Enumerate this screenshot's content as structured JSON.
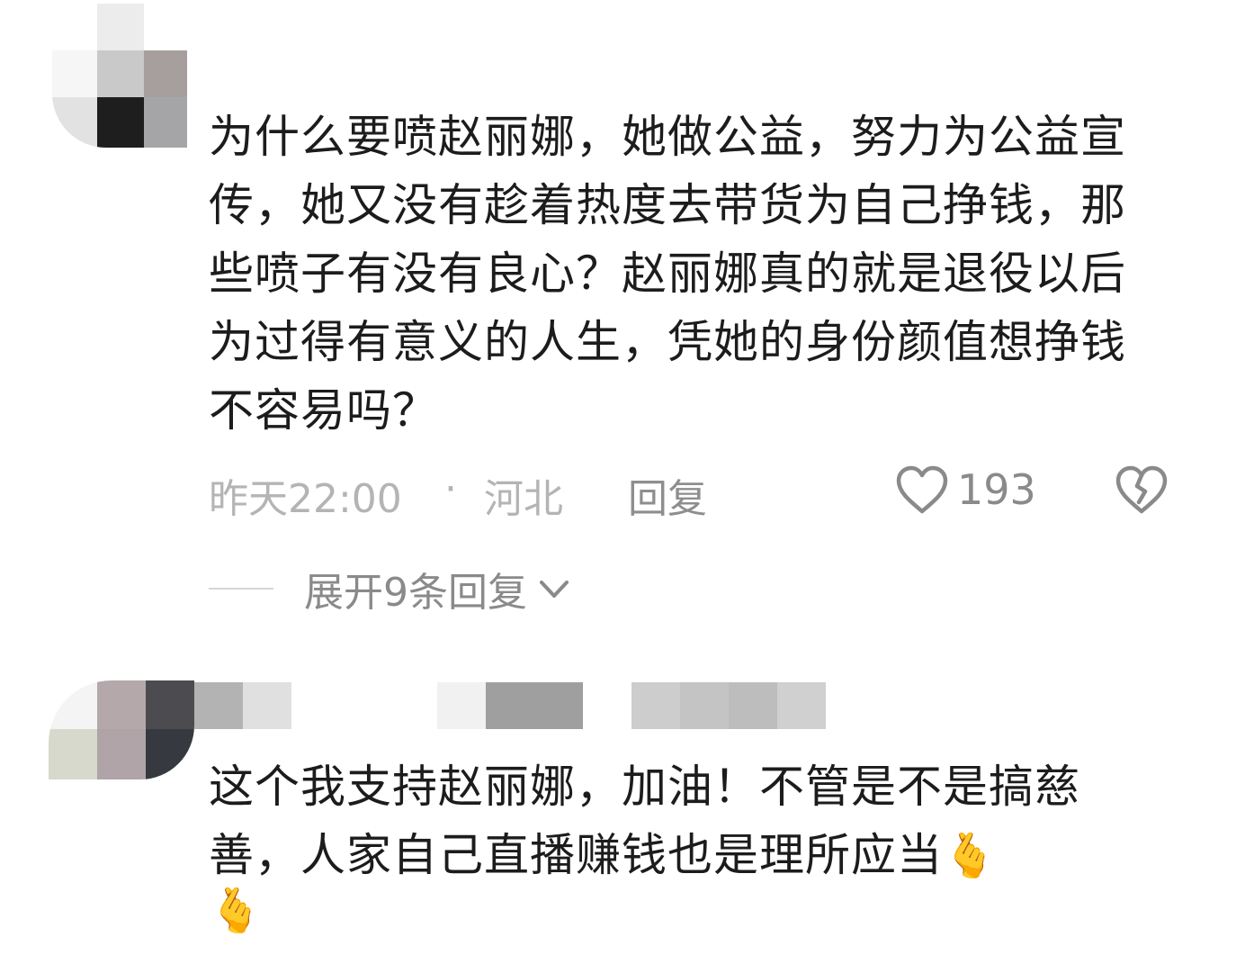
{
  "comments": [
    {
      "text": "为什么要喷赵丽娜，她做公益，努力为公益宣传，她又没有趁着热度去带货为自己挣钱，那些喷子有没有良心？赵丽娜真的就是退役以后为过得有意义的人生，凭她的身份颜值想挣钱不容易吗？",
      "time": "昨天22:00",
      "separator": "·",
      "region": "河北",
      "reply_label": "回复",
      "like_count": "193",
      "expand_label": "展开9条回复"
    },
    {
      "text": "这个我支持赵丽娜，加油！不管是不是搞慈善，人家自己直播赚钱也是理所应当",
      "emoji_inline": "🫰",
      "emoji_trailing": "🫰"
    }
  ],
  "icons": {
    "like": "heart-outline-icon",
    "dislike": "broken-heart-icon",
    "expand": "chevron-down-icon"
  },
  "colors": {
    "text": "#1c1c1c",
    "meta": "#b4b4b4",
    "action": "#8a8a8a"
  }
}
